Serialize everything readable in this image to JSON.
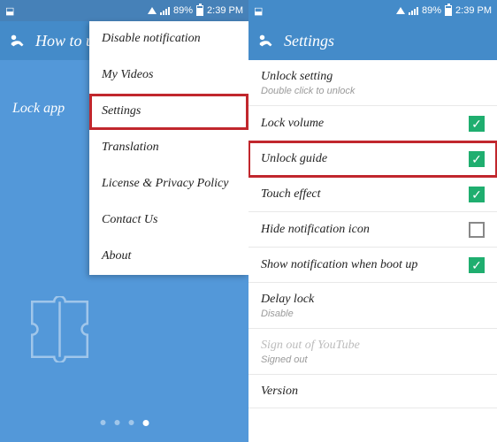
{
  "status": {
    "signal_pct": "89%",
    "time": "2:39 PM"
  },
  "left": {
    "title": "How to use",
    "lock_label": "Lock app",
    "menu": [
      {
        "label": "Disable notification"
      },
      {
        "label": "My Videos"
      },
      {
        "label": "Settings",
        "highlight": true
      },
      {
        "label": "Translation"
      },
      {
        "label": "License & Privacy Policy"
      },
      {
        "label": "Contact Us"
      },
      {
        "label": "About"
      }
    ]
  },
  "right": {
    "title": "Settings",
    "rows": [
      {
        "title": "Unlock setting",
        "sub": "Double click to unlock"
      },
      {
        "title": "Lock volume",
        "checkbox": true,
        "checked": true
      },
      {
        "title": "Unlock guide",
        "checkbox": true,
        "checked": true,
        "highlight": true
      },
      {
        "title": "Touch effect",
        "checkbox": true,
        "checked": true
      },
      {
        "title": "Hide notification icon",
        "checkbox": true,
        "checked": false
      },
      {
        "title": "Show notification when boot up",
        "checkbox": true,
        "checked": true
      },
      {
        "title": "Delay lock",
        "sub": "Disable"
      },
      {
        "title": "Sign out of YouTube",
        "sub": "Signed out",
        "disabled": true
      },
      {
        "title": "Version"
      }
    ]
  }
}
